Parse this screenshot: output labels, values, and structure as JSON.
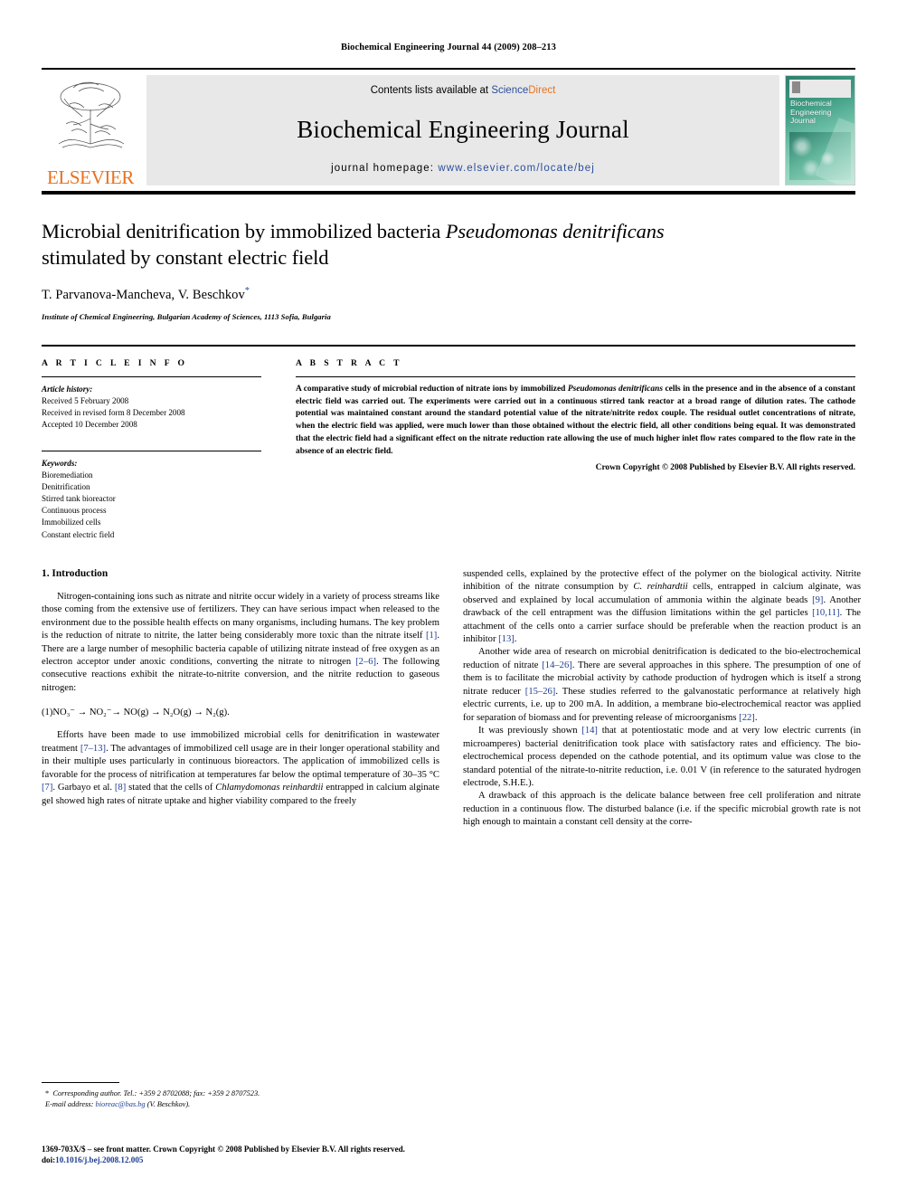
{
  "runhead": "Biochemical Engineering Journal 44 (2009) 208–213",
  "masthead": {
    "publisher": "ELSEVIER",
    "contents_prefix": "Contents lists available at ",
    "contents_link_science": "Science",
    "contents_link_direct": "Direct",
    "journal_title": "Biochemical Engineering Journal",
    "homepage_label": "journal homepage: ",
    "homepage_url": "www.elsevier.com/locate/bej",
    "cover_title_lines": [
      "Biochemical",
      "Engineering",
      "Journal"
    ]
  },
  "article": {
    "title_part1": "Microbial denitrification by immobilized bacteria ",
    "title_italic": "Pseudomonas denitrificans",
    "title_part2": "stimulated by constant electric field",
    "authors": "T. Parvanova-Mancheva, V. Beschkov",
    "author_mark": "*",
    "affiliation": "Institute of Chemical Engineering, Bulgarian Academy of Sciences, 1113 Sofia, Bulgaria"
  },
  "info": {
    "heading": "A R T I C L E    I N F O",
    "history_label": "Article history:",
    "history": [
      "Received 5 February 2008",
      "Received in revised form 8 December 2008",
      "Accepted 10 December 2008"
    ],
    "keywords_label": "Keywords:",
    "keywords": [
      "Bioremediation",
      "Denitrification",
      "Stirred tank bioreactor",
      "Continuous process",
      "Immobilized cells",
      "Constant electric field"
    ]
  },
  "abstract": {
    "heading": "A B S T R A C T",
    "p1a": "A comparative study of microbial reduction of nitrate ions by immobilized ",
    "p1_italic": "Pseudomonas denitrificans",
    "p1b": " cells in the presence and in the absence of a constant electric field was carried out. The experiments were carried out in a continuous stirred tank reactor at a broad range of dilution rates. The cathode potential was maintained constant around the standard potential value of the nitrate/nitrite redox couple. The residual outlet concentrations of nitrate, when the electric field was applied, were much lower than those obtained without the electric field, all other conditions being equal. It was demonstrated that the electric field had a significant effect on the nitrate reduction rate allowing the use of much higher inlet flow rates compared to the flow rate in the absence of an electric field.",
    "copyright": "Crown Copyright © 2008 Published by Elsevier B.V. All rights reserved."
  },
  "body": {
    "section_heading": "1.  Introduction",
    "left": {
      "p1a": "Nitrogen-containing ions such as nitrate and nitrite occur widely in a variety of process streams like those coming from the extensive use of fertilizers. They can have serious impact when released to the environment due to the possible health effects on many organisms, including humans. The key problem is the reduction of nitrate to nitrite, the latter being considerably more toxic than the nitrate itself ",
      "p1_ref1": "[1]",
      "p1b": ". There are a large number of mesophilic bacteria capable of utilizing nitrate instead of free oxygen as an electron acceptor under anoxic conditions, converting the nitrate to nitrogen ",
      "p1_ref2": "[2–6]",
      "p1c": ". The following consecutive reactions exhibit the nitrate-to-nitrite conversion, and the nitrite reduction to gaseous nitrogen:",
      "equation": "(1)NO₃⁻ →  NO₂⁻→  NO(g)  →  N₂O(g)  →  N₂(g).",
      "p2a": "Efforts have been made to use immobilized microbial cells for denitrification in wastewater treatment ",
      "p2_ref1": "[7–13]",
      "p2b": ". The advantages of immobilized cell usage are in their longer operational stability and in their multiple uses particularly in continuous bioreactors. The application of immobilized cells is favorable for the process of nitrification at temperatures far below the optimal temperature of 30–35 °C ",
      "p2_ref2": "[7]",
      "p2c": ". Garbayo et al. ",
      "p2_ref3": "[8]",
      "p2d": " stated that the cells of ",
      "p2_italic": "Chlamydomonas reinhardtii",
      "p2e": " entrapped in calcium alginate gel showed high rates of nitrate uptake and higher viability compared to the freely"
    },
    "right": {
      "p3a": "suspended cells, explained by the protective effect of the polymer on the biological activity. Nitrite inhibition of the nitrate consumption by ",
      "p3_italic": "C. reinhardtii",
      "p3b": " cells, entrapped in calcium alginate, was observed and explained by local accumulation of ammonia within the alginate beads ",
      "p3_ref1": "[9]",
      "p3c": ". Another drawback of the cell entrapment was the diffusion limitations within the gel particles ",
      "p3_ref2": "[10,11]",
      "p3d": ". The attachment of the cells onto a carrier surface should be preferable when the reaction product is an inhibitor ",
      "p3_ref3": "[13]",
      "p3e": ".",
      "p4a": "Another wide area of research on microbial denitrification is dedicated to the bio-electrochemical reduction of nitrate ",
      "p4_ref1": "[14–26]",
      "p4b": ". There are several approaches in this sphere. The presumption of one of them is to facilitate the microbial activity by cathode production of hydrogen which is itself a strong nitrate reducer ",
      "p4_ref2": "[15–26]",
      "p4c": ". These studies referred to the galvanostatic performance at relatively high electric currents, i.e. up to 200 mA. In addition, a membrane bio-electrochemical reactor was applied for separation of biomass and for preventing release of microorganisms ",
      "p4_ref3": "[22]",
      "p4d": ".",
      "p5a": "It was previously shown ",
      "p5_ref1": "[14]",
      "p5b": " that at potentiostatic mode and at very low electric currents (in microamperes) bacterial denitrification took place with satisfactory rates and efficiency. The bio-electrochemical process depended on the cathode potential, and its optimum value was close to the standard potential of the nitrate-to-nitrite reduction, i.e. 0.01 V (in reference to the saturated hydrogen electrode, S.H.E.).",
      "p6": "A drawback of this approach is the delicate balance between free cell proliferation and nitrate reduction in a continuous flow. The disturbed balance (i.e. if the specific microbial growth rate is not high enough to maintain a constant cell density at the corre-"
    }
  },
  "footnote": {
    "mark": "*",
    "corresponding": "Corresponding author. Tel.: +359 2 8702088; fax: +359 2 8707523.",
    "email_label": "E-mail address:",
    "email": "bioreac@bas.bg",
    "email_person": "(V. Beschkov)."
  },
  "page_footer": {
    "line1": "1369-703X/$ – see front matter. Crown Copyright © 2008 Published by Elsevier B.V. All rights reserved.",
    "doi_label": "doi:",
    "doi": "10.1016/j.bej.2008.12.005"
  }
}
